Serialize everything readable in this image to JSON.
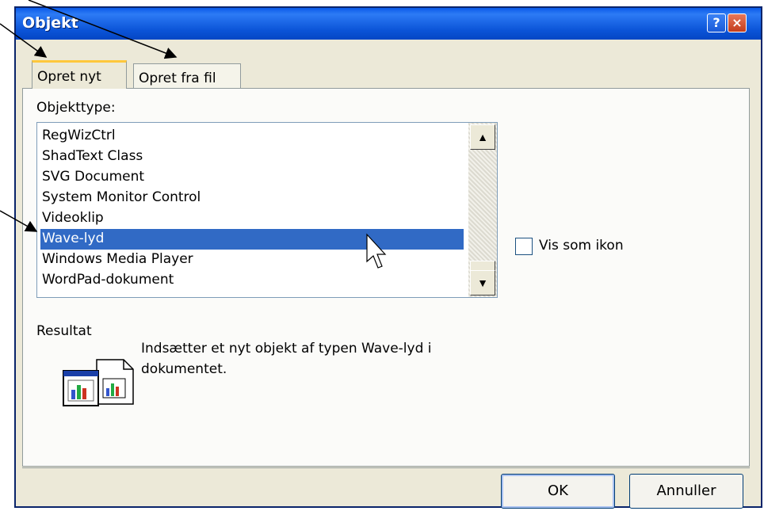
{
  "window": {
    "title": "Objekt"
  },
  "titlebar": {
    "help_label": "?",
    "close_label": "×"
  },
  "tabs": [
    {
      "label": "Opret nyt",
      "active": true
    },
    {
      "label": "Opret fra fil",
      "active": false
    }
  ],
  "object_type": {
    "label": "Objekttype:",
    "items": [
      "RegWizCtrl",
      "ShadText Class",
      "SVG Document",
      "System Monitor Control",
      "Videoklip",
      "Wave-lyd",
      "Windows Media Player",
      "WordPad-dokument"
    ],
    "selected": "Wave-lyd",
    "scroll_up_label": "▲",
    "scroll_down_label": "▼"
  },
  "display_as_icon": {
    "label": "Vis som ikon",
    "checked": false
  },
  "result": {
    "label": "Resultat",
    "description_line1": "Indsætter et nyt objekt af typen Wave-lyd i",
    "description_line2": "dokumentet."
  },
  "buttons": {
    "ok_label": "OK",
    "cancel_label": "Annuller"
  },
  "colors": {
    "titlebar": "#0a5ae8",
    "selection": "#316ac5",
    "dialog_bg": "#ece9d8"
  }
}
